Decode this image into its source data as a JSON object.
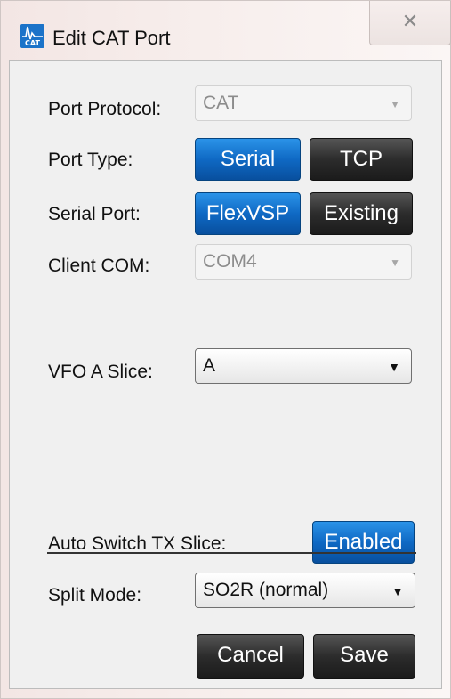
{
  "window": {
    "title": "Edit CAT Port",
    "icon": "flexradio-cat-app-icon",
    "icon_text": "CAT",
    "close_glyph": "✕",
    "accent_color": "#1b73c9"
  },
  "form": {
    "port_protocol": {
      "label": "Port Protocol:",
      "value": "CAT",
      "enabled": false
    },
    "port_type": {
      "label": "Port Type:",
      "options": [
        "Serial",
        "TCP"
      ],
      "selected": "Serial"
    },
    "serial_port": {
      "label": "Serial Port:",
      "options": [
        "FlexVSP",
        "Existing"
      ],
      "selected": "FlexVSP"
    },
    "client_com": {
      "label": "Client COM:",
      "value": "COM4",
      "enabled": false
    },
    "vfo_a_slice": {
      "label": "VFO A Slice:",
      "value": "A",
      "enabled": true
    },
    "auto_switch_tx_slice": {
      "label": "Auto Switch TX Slice:",
      "button": "Enabled",
      "state": "on"
    },
    "split_mode": {
      "label": "Split Mode:",
      "value": "SO2R (normal)",
      "enabled": true
    }
  },
  "actions": {
    "cancel": "Cancel",
    "save": "Save"
  },
  "colors": {
    "selected_button": "#0f69c4",
    "unselected_button": "#2c2c2c"
  }
}
